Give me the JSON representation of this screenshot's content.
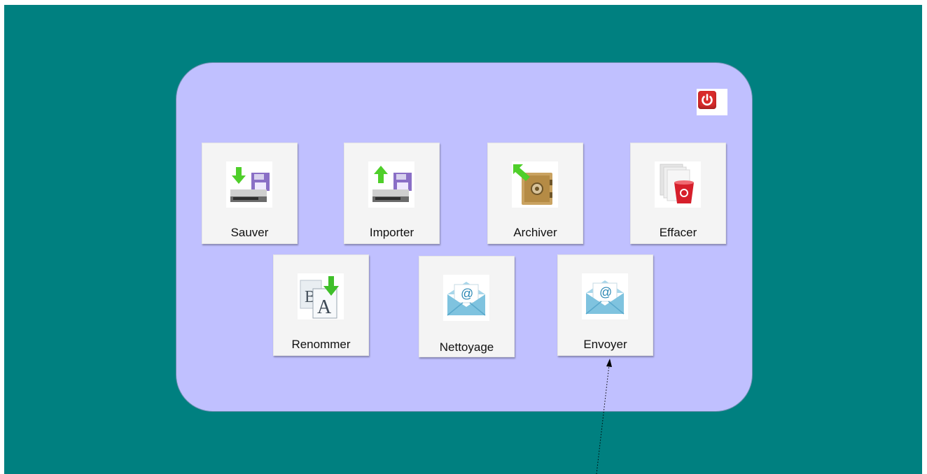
{
  "colors": {
    "desktop_background": "#008080",
    "panel_background": "#c0c0ff",
    "tile_background": "#f4f4f4",
    "power_button": "#d92b2b",
    "arrow_icon_green": "#4fcf2a"
  },
  "power_button": {
    "icon": "power-icon"
  },
  "tiles": [
    {
      "label": "Sauver",
      "icon": "save-to-disk-icon"
    },
    {
      "label": "Importer",
      "icon": "import-from-disk-icon"
    },
    {
      "label": "Archiver",
      "icon": "archive-safe-icon"
    },
    {
      "label": "Effacer",
      "icon": "delete-trash-icon"
    },
    {
      "label": "Renommer",
      "icon": "rename-icon"
    },
    {
      "label": "Nettoyage",
      "icon": "email-envelope-icon"
    },
    {
      "label": "Envoyer",
      "icon": "email-envelope-icon"
    }
  ]
}
